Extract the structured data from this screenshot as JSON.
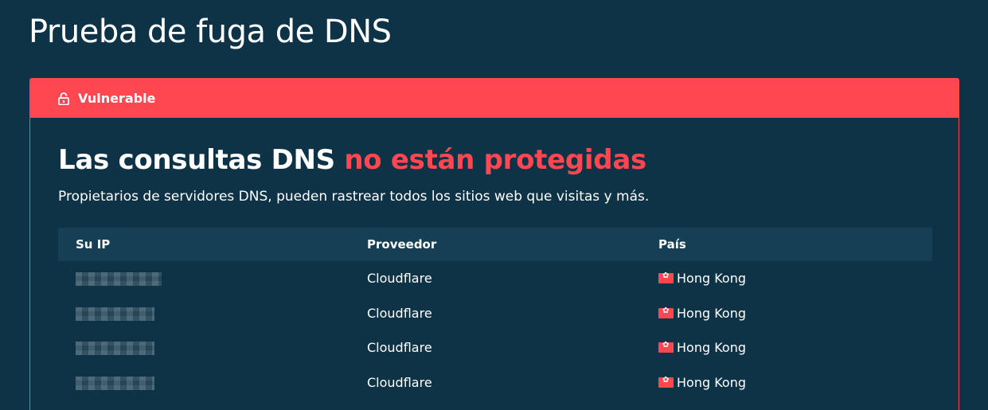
{
  "page": {
    "title": "Prueba de fuga de DNS"
  },
  "status": {
    "label": "Vulnerable",
    "icon": "unlocked-padlock-icon",
    "color": "#ff4751"
  },
  "result": {
    "headline_normal": "Las consultas DNS ",
    "headline_alert": "no están protegidas",
    "description": "Propietarios de servidores DNS, pueden rastrear todos los sitios web que visitas y más."
  },
  "table": {
    "headers": {
      "ip": "Su IP",
      "provider": "Proveedor",
      "country": "País"
    },
    "rows": [
      {
        "ip": "",
        "provider": "Cloudflare",
        "country": "Hong Kong",
        "flag_icon": "hong-kong-flag-icon"
      },
      {
        "ip": "",
        "provider": "Cloudflare",
        "country": "Hong Kong",
        "flag_icon": "hong-kong-flag-icon"
      },
      {
        "ip": "",
        "provider": "Cloudflare",
        "country": "Hong Kong",
        "flag_icon": "hong-kong-flag-icon"
      },
      {
        "ip": "",
        "provider": "Cloudflare",
        "country": "Hong Kong",
        "flag_icon": "hong-kong-flag-icon"
      }
    ]
  },
  "colors": {
    "background": "#0e3347",
    "table_header": "#153f55",
    "alert": "#ff4751",
    "text": "#ffffff"
  }
}
